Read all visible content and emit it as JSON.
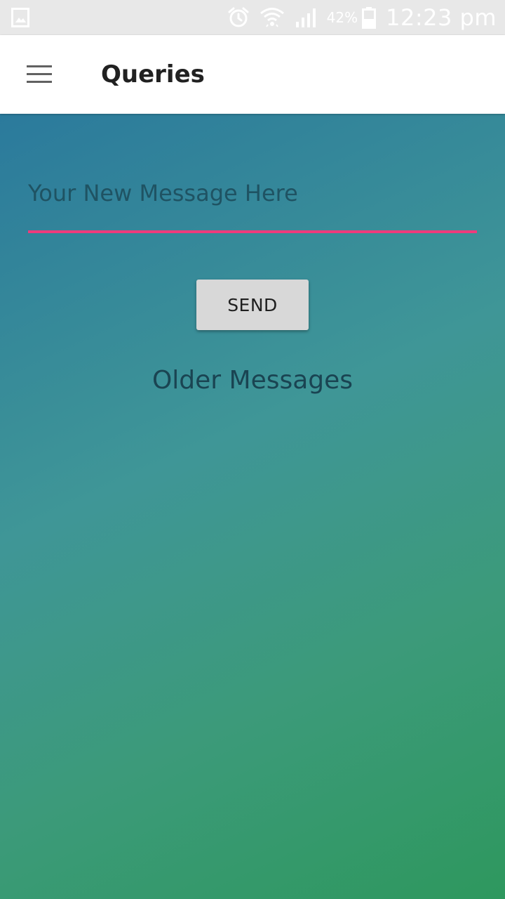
{
  "status_bar": {
    "left_icon": "image-notification-icon",
    "icons": [
      "alarm-icon",
      "wifi-icon",
      "signal-icon",
      "battery-icon"
    ],
    "battery_percent": "42%",
    "time": "12:23 pm"
  },
  "app_bar": {
    "menu_icon": "hamburger-menu-icon",
    "title": "Queries"
  },
  "compose": {
    "placeholder": "Your New Message Here",
    "value": "",
    "send_label": "SEND"
  },
  "older": {
    "heading": "Older Messages"
  },
  "colors": {
    "status_bar_bg": "#e8e8e8",
    "app_bar_bg": "#ffffff",
    "gradient_start": "#2b7a9c",
    "gradient_end": "#2e985e",
    "input_underline": "#ee3b7c",
    "button_bg": "#d8d8d8"
  }
}
